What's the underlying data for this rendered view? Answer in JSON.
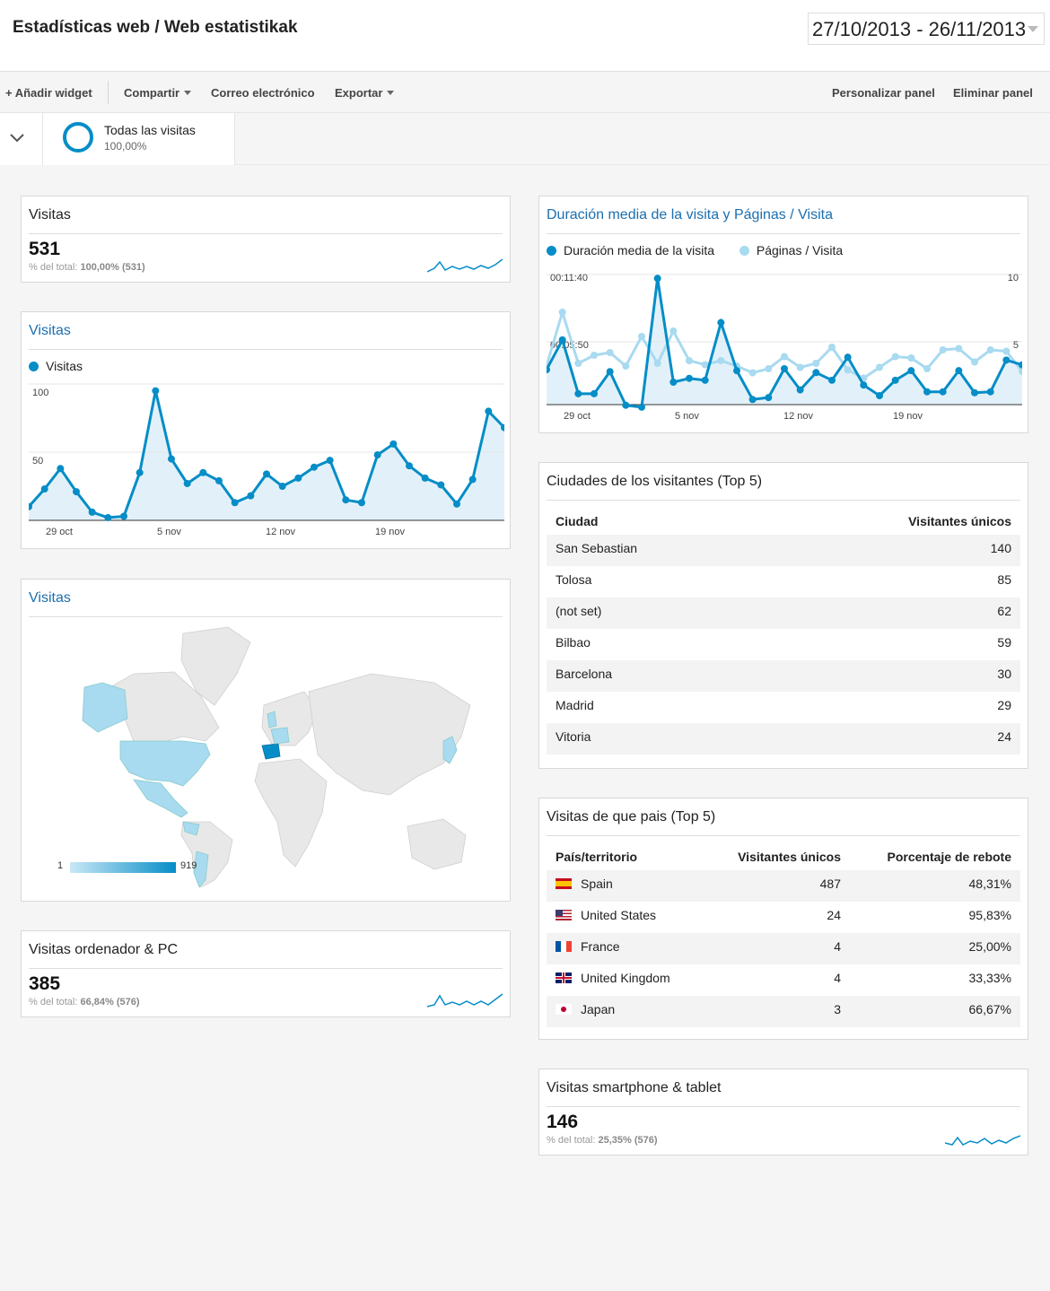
{
  "header": {
    "title": "Estadísticas web / Web estatistikak",
    "date_range": "27/10/2013 - 26/11/2013"
  },
  "toolbar": {
    "add_widget": "+ Añadir widget",
    "share": "Compartir",
    "email": "Correo electrónico",
    "export": "Exportar",
    "customize": "Personalizar panel",
    "delete": "Eliminar panel"
  },
  "segment": {
    "name": "Todas las visitas",
    "percent": "100,00%"
  },
  "colors": {
    "primary": "#058dc7",
    "secondary": "#a8daf0",
    "fill": "#e2f1f9",
    "title_blue": "#1b6fb0"
  },
  "visits_metric": {
    "title": "Visitas",
    "value": "531",
    "sub_label": "% del total:",
    "sub_value": "100,00% (531)"
  },
  "visits_chart": {
    "title": "Visitas",
    "legend": "Visitas",
    "y_ticks": [
      "100",
      "50"
    ],
    "x_ticks": [
      "29 oct",
      "5 nov",
      "12 nov",
      "19 nov"
    ]
  },
  "map_widget": {
    "title": "Visitas",
    "scale_min": "1",
    "scale_max": "919"
  },
  "desktop_metric": {
    "title": "Visitas ordenador & PC",
    "value": "385",
    "sub_label": "% del total:",
    "sub_value": "66,84% (576)"
  },
  "duration_chart": {
    "title": "Duración media de la visita y Páginas / Visita",
    "legend_a": "Duración media de la visita",
    "legend_b": "Páginas / Visita",
    "y_left_ticks": [
      "00:11:40",
      "00:05:50"
    ],
    "y_right_ticks": [
      "10",
      "5"
    ],
    "x_ticks": [
      "29 oct",
      "5 nov",
      "12 nov",
      "19 nov"
    ]
  },
  "cities": {
    "title": "Ciudades de los visitantes (Top 5)",
    "col_city": "Ciudad",
    "col_visitors": "Visitantes únicos",
    "rows": [
      {
        "city": "San Sebastian",
        "visitors": "140"
      },
      {
        "city": "Tolosa",
        "visitors": "85"
      },
      {
        "city": "(not set)",
        "visitors": "62"
      },
      {
        "city": "Bilbao",
        "visitors": "59"
      },
      {
        "city": "Barcelona",
        "visitors": "30"
      },
      {
        "city": "Madrid",
        "visitors": "29"
      },
      {
        "city": "Vitoria",
        "visitors": "24"
      }
    ]
  },
  "countries": {
    "title": "Visitas de que pais (Top 5)",
    "col_country": "País/territorio",
    "col_visitors": "Visitantes únicos",
    "col_bounce": "Porcentaje de rebote",
    "rows": [
      {
        "country": "Spain",
        "visitors": "487",
        "bounce": "48,31%"
      },
      {
        "country": "United States",
        "visitors": "24",
        "bounce": "95,83%"
      },
      {
        "country": "France",
        "visitors": "4",
        "bounce": "25,00%"
      },
      {
        "country": "United Kingdom",
        "visitors": "4",
        "bounce": "33,33%"
      },
      {
        "country": "Japan",
        "visitors": "3",
        "bounce": "66,67%"
      }
    ]
  },
  "mobile_metric": {
    "title": "Visitas smartphone & tablet",
    "value": "146",
    "sub_label": "% del total:",
    "sub_value": "25,35% (576)"
  },
  "chart_data": [
    {
      "type": "line",
      "title": "Visitas",
      "xlabel": "",
      "ylabel": "",
      "x": [
        "27 oct",
        "28 oct",
        "29 oct",
        "30 oct",
        "31 oct",
        "1 nov",
        "2 nov",
        "3 nov",
        "4 nov",
        "5 nov",
        "6 nov",
        "7 nov",
        "8 nov",
        "9 nov",
        "10 nov",
        "11 nov",
        "12 nov",
        "13 nov",
        "14 nov",
        "15 nov",
        "16 nov",
        "17 nov",
        "18 nov",
        "19 nov",
        "20 nov",
        "21 nov",
        "22 nov",
        "23 nov",
        "24 nov",
        "25 nov",
        "26 nov"
      ],
      "x_ticks": [
        "29 oct",
        "5 nov",
        "12 nov",
        "19 nov"
      ],
      "ylim": [
        0,
        100
      ],
      "y_ticks": [
        100,
        50
      ],
      "series": [
        {
          "name": "Visitas",
          "values": [
            10,
            23,
            38,
            21,
            6,
            2,
            3,
            35,
            95,
            45,
            27,
            35,
            29,
            13,
            18,
            34,
            25,
            31,
            39,
            44,
            15,
            13,
            48,
            56,
            40,
            31,
            26,
            12,
            30,
            80,
            68
          ]
        }
      ]
    },
    {
      "type": "line",
      "title": "Duración media de la visita y Páginas / Visita",
      "xlabel": "",
      "ylabel": "",
      "x": [
        "27 oct",
        "28 oct",
        "29 oct",
        "30 oct",
        "31 oct",
        "1 nov",
        "2 nov",
        "3 nov",
        "4 nov",
        "5 nov",
        "6 nov",
        "7 nov",
        "8 nov",
        "9 nov",
        "10 nov",
        "11 nov",
        "12 nov",
        "13 nov",
        "14 nov",
        "15 nov",
        "16 nov",
        "17 nov",
        "18 nov",
        "19 nov",
        "20 nov",
        "21 nov",
        "22 nov",
        "23 nov",
        "24 nov",
        "25 nov",
        "26 nov"
      ],
      "x_ticks": [
        "29 oct",
        "5 nov",
        "12 nov",
        "19 nov"
      ],
      "y_left_ticks": [
        "00:11:40",
        "00:05:50"
      ],
      "y_right_ticks": [
        10,
        5
      ],
      "series": [
        {
          "name": "Duración media de la visita",
          "axis": "left",
          "unit": "seconds",
          "values": [
            205,
            360,
            80,
            80,
            195,
            20,
            10,
            680,
            140,
            160,
            150,
            450,
            200,
            50,
            60,
            210,
            100,
            190,
            150,
            270,
            125,
            70,
            150,
            200,
            90,
            90,
            200,
            85,
            90,
            255,
            230
          ]
        },
        {
          "name": "Páginas / Visita",
          "axis": "right",
          "values": [
            3.2,
            7.2,
            3.4,
            4.0,
            4.2,
            3.2,
            5.4,
            3.4,
            5.8,
            3.6,
            3.3,
            3.6,
            3.2,
            2.7,
            3.0,
            3.9,
            3.1,
            3.4,
            4.6,
            2.9,
            2.3,
            3.1,
            3.9,
            3.8,
            3.0,
            4.4,
            4.5,
            3.5,
            4.4,
            4.3,
            2.8
          ]
        }
      ]
    }
  ]
}
